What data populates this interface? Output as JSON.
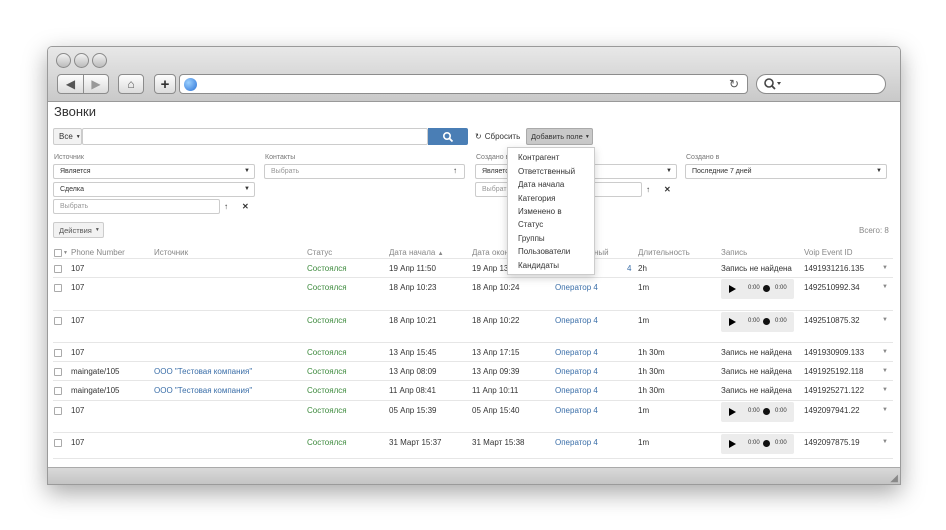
{
  "page": {
    "title": "Звонки"
  },
  "browser": {
    "reload_icon": "reload-icon",
    "search_icon": "search-icon"
  },
  "filter_bar": {
    "scope_button": "Все",
    "search_placeholder": "",
    "reset_button": "Сбросить",
    "add_field_button": "Добавить поле"
  },
  "filters": {
    "source": {
      "label": "Источник",
      "condition": "Является",
      "value": "Сделка",
      "picker_placeholder": "Выбрать"
    },
    "contacts": {
      "label": "Контакты",
      "picker_placeholder": "Выбрать"
    },
    "created_in": {
      "label": "Создано в",
      "condition": "Является",
      "picker_placeholder": "Выбрать"
    },
    "created_at": {
      "label": "Создано в",
      "value": "Последние 7 дней"
    }
  },
  "add_field_menu": {
    "items": [
      "Контрагент",
      "Ответственный",
      "Дата начала",
      "Категория",
      "Изменено в",
      "Статус",
      "Группы",
      "Пользователи",
      "Кандидаты"
    ]
  },
  "actions_button": "Действия",
  "total": "Всего: 8",
  "table": {
    "columns": [
      "Phone Number",
      "Источник",
      "Статус",
      "Дата начала",
      "Дата окон",
      "ный",
      "Длительность",
      "Запись",
      "Voip Event ID"
    ],
    "rows": [
      {
        "phone": "107",
        "source": "",
        "status": "Состоялся",
        "start": "19 Апр 11:50",
        "end": "19 Апр 13",
        "operator": "4",
        "duration": "2h",
        "record": "Запись не найдена",
        "voip": "1491931216.135"
      },
      {
        "phone": "107",
        "source": "",
        "status": "Состоялся",
        "start": "18 Апр 10:23",
        "end": "18 Апр 10:24",
        "operator": "Оператор 4",
        "duration": "1m",
        "record": "",
        "voip": "1492510992.34"
      },
      {
        "phone": "107",
        "source": "",
        "status": "Состоялся",
        "start": "18 Апр 10:21",
        "end": "18 Апр 10:22",
        "operator": "Оператор 4",
        "duration": "1m",
        "record": "",
        "voip": "1492510875.32"
      },
      {
        "phone": "107",
        "source": "",
        "status": "Состоялся",
        "start": "13 Апр 15:45",
        "end": "13 Апр 17:15",
        "operator": "Оператор 4",
        "duration": "1h 30m",
        "record": "Запись не найдена",
        "voip": "1491930909.133"
      },
      {
        "phone": "maingate/105",
        "source": "ООО \"Тестовая компания\"",
        "status": "Состоялся",
        "start": "13 Апр 08:09",
        "end": "13 Апр 09:39",
        "operator": "Оператор 4",
        "duration": "1h 30m",
        "record": "Запись не найдена",
        "voip": "1491925192.118"
      },
      {
        "phone": "maingate/105",
        "source": "ООО \"Тестовая компания\"",
        "status": "Состоялся",
        "start": "11 Апр 08:41",
        "end": "11 Апр 10:11",
        "operator": "Оператор 4",
        "duration": "1h 30m",
        "record": "Запись не найдена",
        "voip": "1491925271.122"
      },
      {
        "phone": "107",
        "source": "",
        "status": "Состоялся",
        "start": "05 Апр 15:39",
        "end": "05 Апр 15:40",
        "operator": "Оператор 4",
        "duration": "1m",
        "record": "",
        "voip": "1492097941.22"
      },
      {
        "phone": "107",
        "source": "",
        "status": "Состоялся",
        "start": "31 Март 15:37",
        "end": "31 Март 15:38",
        "operator": "Оператор 4",
        "duration": "1m",
        "record": "",
        "voip": "1492097875.19"
      }
    ]
  },
  "player": {
    "time_start": "0:00",
    "time_end": "0:00"
  }
}
